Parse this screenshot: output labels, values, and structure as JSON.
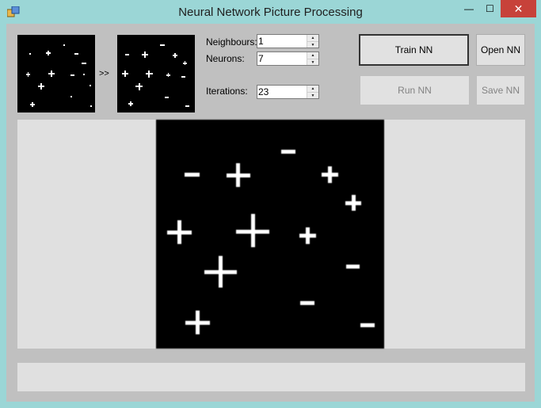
{
  "window": {
    "title": "Neural Network Picture Processing",
    "controls": {
      "minimize": "—",
      "maximize": "☐",
      "close": "✕"
    }
  },
  "preview": {
    "arrow": ">>"
  },
  "params": {
    "neighbours_label": "Neighbours:",
    "neighbours_value": "1",
    "neurons_label": "Neurons:",
    "neurons_value": "7",
    "iterations_label": "Iterations:",
    "iterations_value": "23"
  },
  "buttons": {
    "train": "Train NN",
    "open": "Open NN",
    "run": "Run NN",
    "save": "Save NN"
  },
  "icons": {
    "spin_up": "▲",
    "spin_down": "▼"
  },
  "status": {
    "text": ""
  }
}
